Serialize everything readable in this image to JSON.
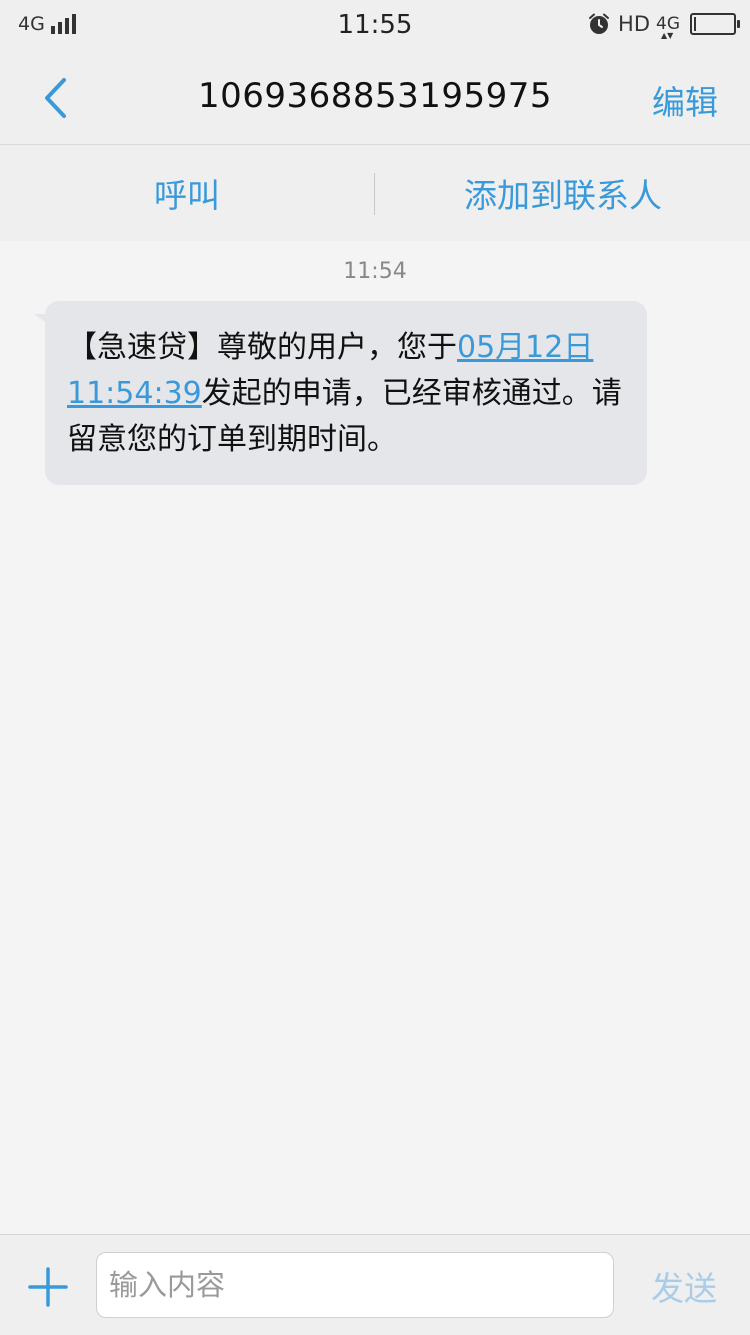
{
  "status_bar": {
    "network": "4G",
    "time": "11:55",
    "hd": "HD",
    "network2": "4G",
    "battery_level": 0.05,
    "icons": [
      "signal-icon",
      "alarm-icon",
      "battery-icon"
    ]
  },
  "header": {
    "back_icon": "chevron-left-icon",
    "title": "1069368853195975",
    "edit_label": "编辑"
  },
  "actions": {
    "call_label": "呼叫",
    "add_contact_label": "添加到联系人"
  },
  "conversation": {
    "time": "11:54",
    "message": {
      "before_link": "【急速贷】尊敬的用户，您于",
      "link": "05月12日 11:54:39",
      "after_link": "发起的申请，已经审核通过。请留意您的订单到期时间。"
    }
  },
  "input_bar": {
    "add_icon": "plus-icon",
    "placeholder": "输入内容",
    "send_label": "发送"
  },
  "colors": {
    "accent": "#3a9ad9",
    "bubble": "#e4e6e9",
    "background": "#f4f4f4",
    "send_disabled": "#a9cde9"
  }
}
